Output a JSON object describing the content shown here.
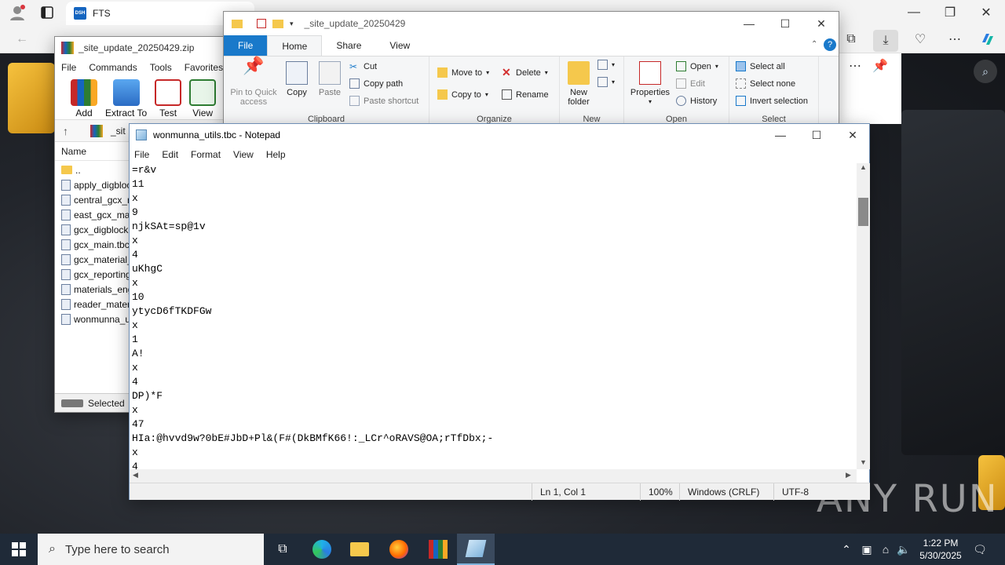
{
  "browser": {
    "tab_title": "FTS",
    "tab_favicon": "DSH"
  },
  "explorer": {
    "title": "_site_update_20250429",
    "tabs": [
      "File",
      "Home",
      "Share",
      "View"
    ],
    "clipboard": {
      "pin_label": "Pin to Quick access",
      "copy_label": "Copy",
      "paste_label": "Paste",
      "cut_label": "Cut",
      "copy_path_label": "Copy path",
      "paste_shortcut_label": "Paste shortcut",
      "group_label": "Clipboard"
    },
    "organize": {
      "move_to_label": "Move to",
      "copy_to_label": "Copy to",
      "delete_label": "Delete",
      "rename_label": "Rename",
      "group_label": "Organize"
    },
    "new": {
      "new_folder_label": "New folder",
      "group_label": "New"
    },
    "open": {
      "properties_label": "Properties",
      "open_label": "Open",
      "edit_label": "Edit",
      "history_label": "History",
      "group_label": "Open"
    },
    "select": {
      "select_all_label": "Select all",
      "select_none_label": "Select none",
      "invert_label": "Invert selection",
      "group_label": "Select"
    }
  },
  "winrar": {
    "title": "_site_update_20250429.zip",
    "menu": [
      "File",
      "Commands",
      "Tools",
      "Favorites"
    ],
    "toolbar": [
      "Add",
      "Extract To",
      "Test",
      "View"
    ],
    "path_text": "_sit",
    "column_name": "Name",
    "files": [
      "..",
      "apply_digbloc",
      "central_gcx_r",
      "east_gcx_mas",
      "gcx_digblock",
      "gcx_main.tbc",
      "gcx_material_",
      "gcx_reporting",
      "materials_eng",
      "reader_mater",
      "wonmunna_u"
    ],
    "status": "Selected"
  },
  "notepad": {
    "title": "wonmunna_utils.tbc - Notepad",
    "menu": [
      "File",
      "Edit",
      "Format",
      "View",
      "Help"
    ],
    "lines": [
      "=r&v",
      "11",
      "x",
      "9",
      "njkSAt=sp@1v",
      "x",
      "4",
      "uKhgC",
      "x",
      "10",
      "ytycD6fTKDFGw",
      "x",
      "1",
      "A!",
      "x",
      "4",
      "DP)*F",
      "x",
      "47",
      "HIa:@hvvd9w?0bE#JbD+Pl&(F#(DkBMfK66!:_LCr^oRAVS@OA;rTfDbx;-",
      "x",
      "4"
    ],
    "status": {
      "position": "Ln 1, Col 1",
      "zoom": "100%",
      "line_ending": "Windows (CRLF)",
      "encoding": "UTF-8"
    }
  },
  "taskbar": {
    "search_placeholder": "Type here to search",
    "time": "1:22 PM",
    "date": "5/30/2025"
  },
  "watermark": "ANY RUN",
  "colors": {
    "ribbon_file_tab": "#1979ca",
    "taskbar": "#1f2a38",
    "accent": "#1979ca"
  }
}
